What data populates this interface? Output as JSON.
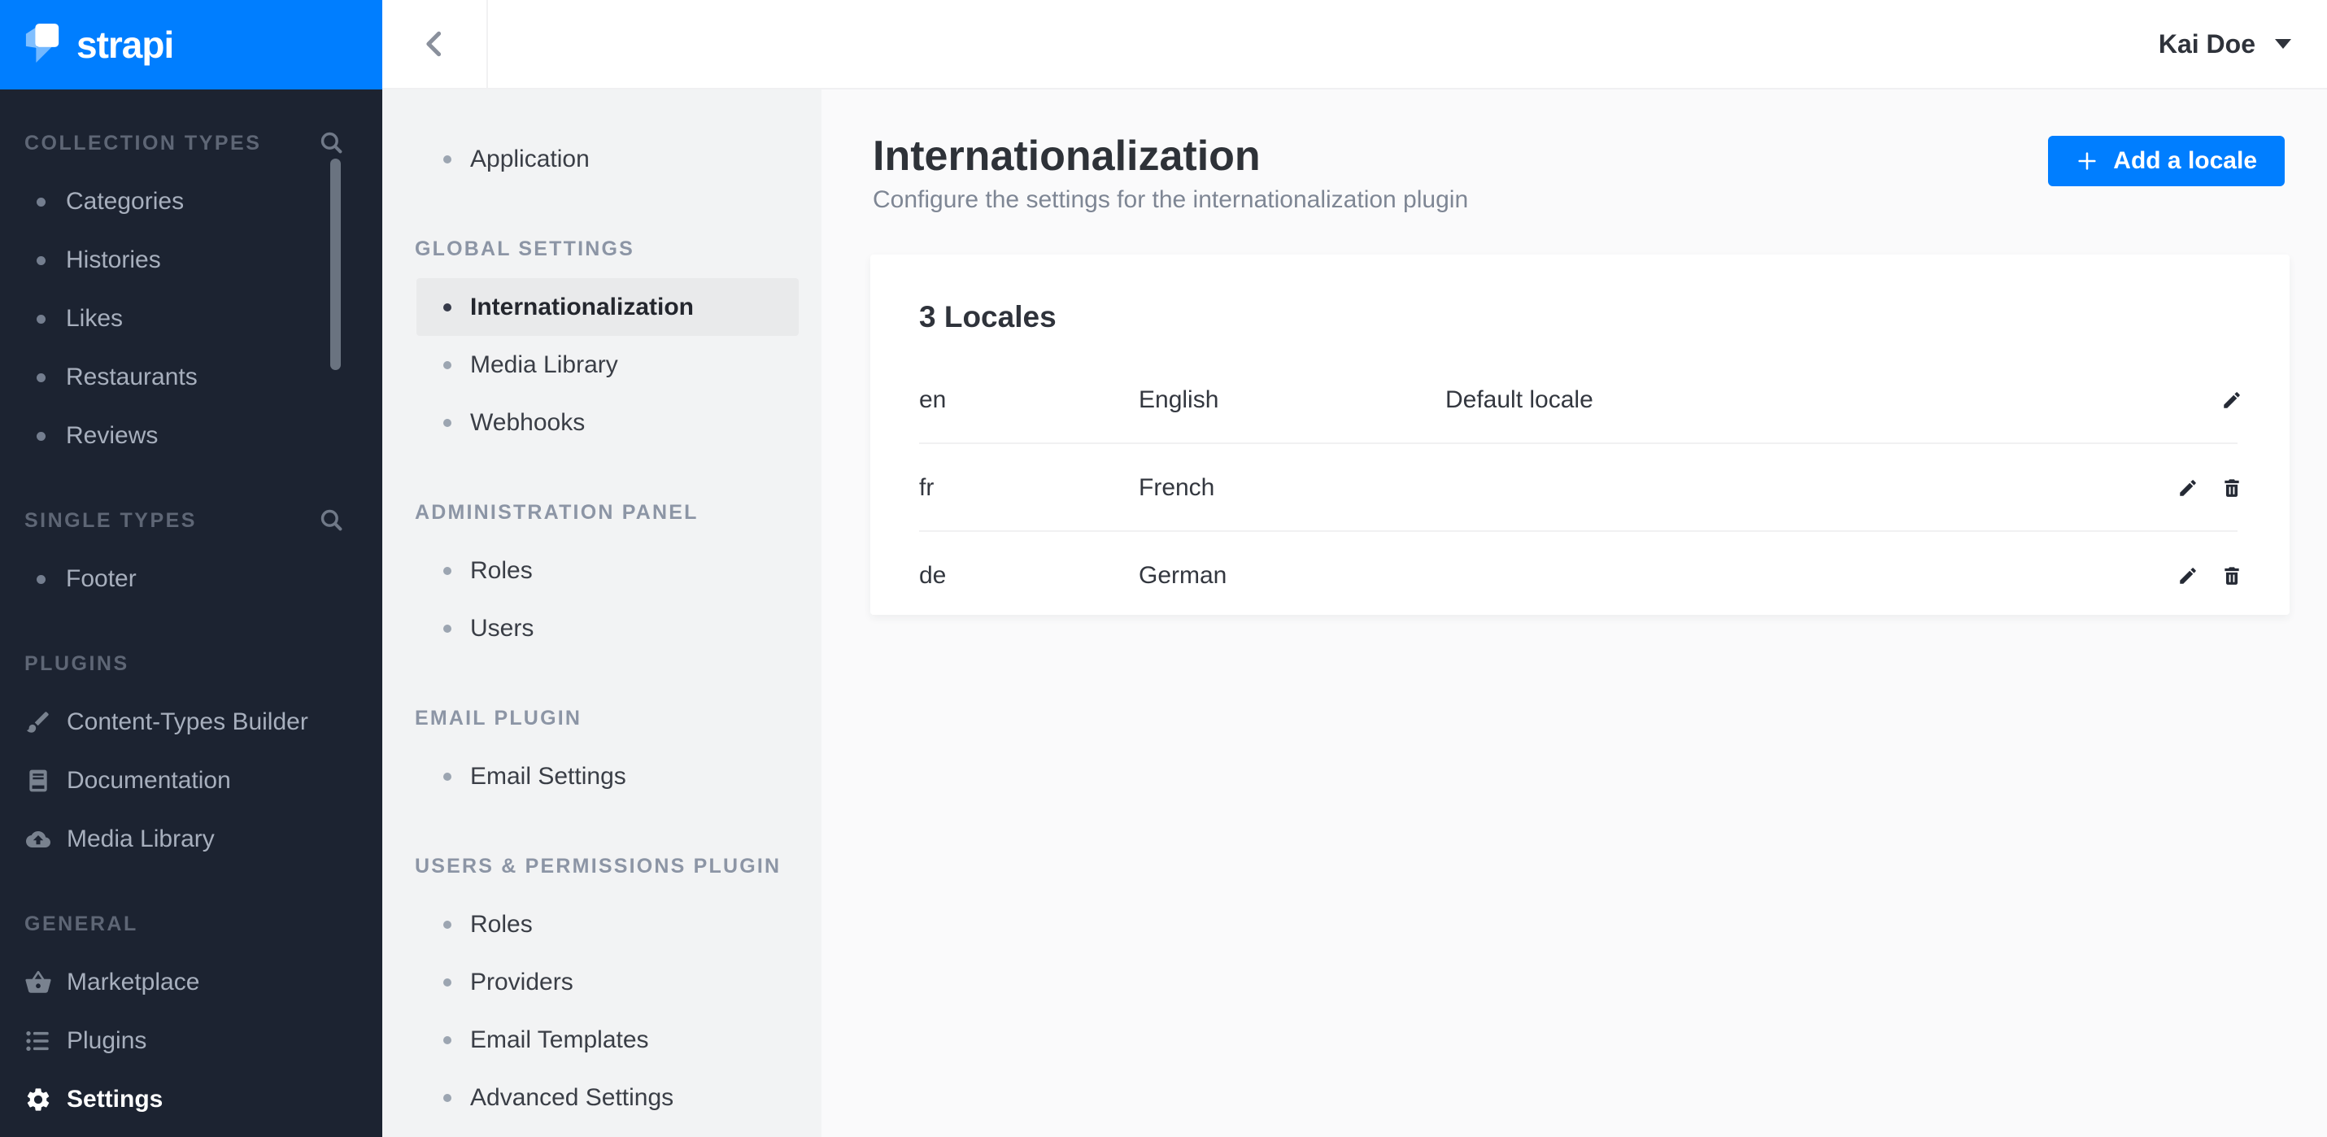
{
  "brand": {
    "logo_text": "strapi"
  },
  "header": {
    "user_name": "Kai Doe",
    "back_icon": "chevron-left-icon",
    "user_caret_icon": "chevron-down-icon"
  },
  "colors": {
    "brand_blue": "#007EFF",
    "sidebar_bg": "#1C2331",
    "subnav_bg": "#F2F3F4",
    "subnav_active_bg": "#E9EAEB",
    "content_bg": "#FAFAFB",
    "text_dark": "#2F333B",
    "text_muted": "#7E8694"
  },
  "sidebar": {
    "sections": [
      {
        "label": "COLLECTION TYPES",
        "search_icon": "search-icon",
        "items": [
          {
            "label": "Categories"
          },
          {
            "label": "Histories"
          },
          {
            "label": "Likes"
          },
          {
            "label": "Restaurants"
          },
          {
            "label": "Reviews"
          }
        ]
      },
      {
        "label": "SINGLE TYPES",
        "search_icon": "search-icon",
        "items": [
          {
            "label": "Footer"
          }
        ]
      },
      {
        "label": "PLUGINS",
        "items": [
          {
            "label": "Content-Types Builder",
            "icon": "paintbrush-icon"
          },
          {
            "label": "Documentation",
            "icon": "book-icon"
          },
          {
            "label": "Media Library",
            "icon": "cloud-upload-icon"
          }
        ]
      },
      {
        "label": "GENERAL",
        "items": [
          {
            "label": "Marketplace",
            "icon": "basket-icon"
          },
          {
            "label": "Plugins",
            "icon": "list-icon"
          },
          {
            "label": "Settings",
            "icon": "gear-icon",
            "active": true
          }
        ]
      }
    ]
  },
  "settings_nav": {
    "standalone": [
      {
        "label": "Application"
      }
    ],
    "sections": [
      {
        "label": "GLOBAL SETTINGS",
        "items": [
          {
            "label": "Internationalization",
            "active": true
          },
          {
            "label": "Media Library"
          },
          {
            "label": "Webhooks"
          }
        ]
      },
      {
        "label": "ADMINISTRATION PANEL",
        "items": [
          {
            "label": "Roles"
          },
          {
            "label": "Users"
          }
        ]
      },
      {
        "label": "EMAIL PLUGIN",
        "items": [
          {
            "label": "Email Settings"
          }
        ]
      },
      {
        "label": "USERS & PERMISSIONS PLUGIN",
        "items": [
          {
            "label": "Roles"
          },
          {
            "label": "Providers"
          },
          {
            "label": "Email Templates"
          },
          {
            "label": "Advanced Settings"
          }
        ]
      }
    ]
  },
  "content": {
    "title": "Internationalization",
    "subtitle": "Configure the settings for the internationalization plugin",
    "add_button": {
      "label": "Add a locale",
      "icon": "plus-icon"
    },
    "card": {
      "title": "3 Locales",
      "rows": [
        {
          "code": "en",
          "name": "English",
          "note": "Default locale",
          "actions": [
            "edit-icon"
          ]
        },
        {
          "code": "fr",
          "name": "French",
          "note": "",
          "actions": [
            "edit-icon",
            "trash-icon"
          ]
        },
        {
          "code": "de",
          "name": "German",
          "note": "",
          "actions": [
            "edit-icon",
            "trash-icon"
          ]
        }
      ]
    }
  }
}
